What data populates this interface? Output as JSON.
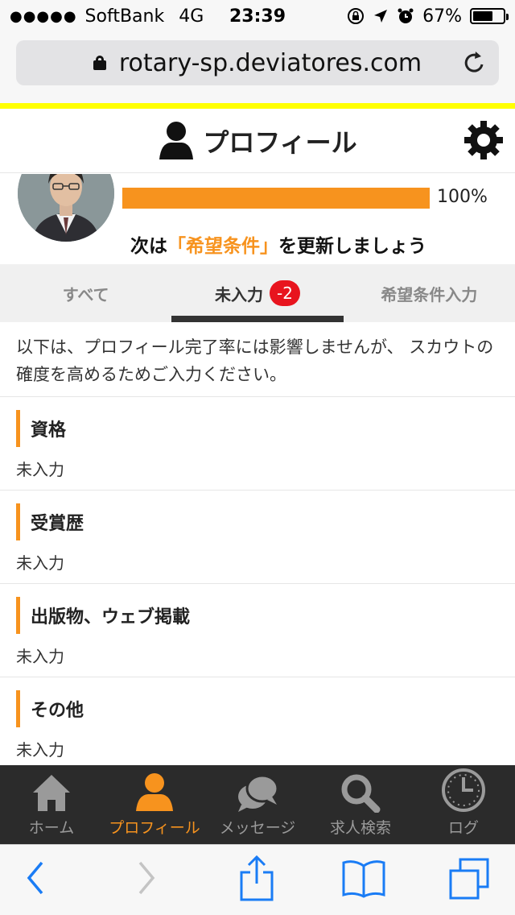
{
  "status_bar": {
    "carrier": "SoftBank",
    "network": "4G",
    "time": "23:39",
    "battery": "67%"
  },
  "browser": {
    "url": "rotary-sp.deviatores.com"
  },
  "header": {
    "title": "プロフィール"
  },
  "profile": {
    "progress_label": "100%",
    "progress_fraction": 1.0,
    "next_prefix": "次は",
    "next_highlight": "「希望条件」",
    "next_suffix": "を更新しましょう"
  },
  "tabs": [
    {
      "label": "すべて"
    },
    {
      "label": "未入力",
      "badge": "-2"
    },
    {
      "label": "希望条件入力"
    }
  ],
  "notice": "以下は、プロフィール完了率には影響しませんが、 スカウトの確度を高めるためご入力ください。",
  "sections": [
    {
      "title": "資格",
      "value": "未入力"
    },
    {
      "title": "受賞歴",
      "value": "未入力"
    },
    {
      "title": "出版物、ウェブ掲載",
      "value": "未入力"
    },
    {
      "title": "その他",
      "value": "未入力"
    }
  ],
  "bottom_nav": [
    {
      "label": "ホーム",
      "icon": "home-icon"
    },
    {
      "label": "プロフィール",
      "icon": "person-icon"
    },
    {
      "label": "メッセージ",
      "icon": "chat-icon"
    },
    {
      "label": "求人検索",
      "icon": "search-icon"
    },
    {
      "label": "ログ",
      "icon": "clock-icon"
    }
  ],
  "colors": {
    "accent": "#f7931e",
    "badge": "#e8141e",
    "nav_bg": "#2b2b2b",
    "strip": "#ffff00",
    "ios_blue": "#1a7cf5"
  }
}
